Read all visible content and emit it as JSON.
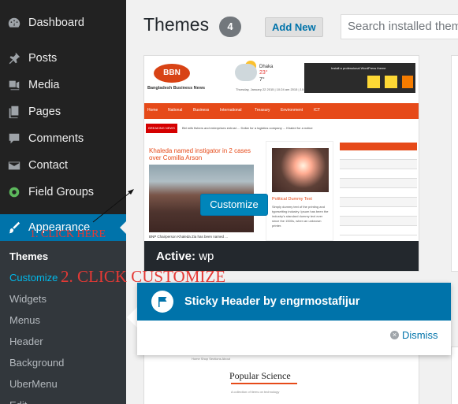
{
  "sidebar": {
    "items": [
      {
        "label": "Dashboard",
        "icon": "dashboard-icon"
      },
      {
        "label": "Posts",
        "icon": "pin-icon"
      },
      {
        "label": "Media",
        "icon": "media-icon"
      },
      {
        "label": "Pages",
        "icon": "pages-icon"
      },
      {
        "label": "Comments",
        "icon": "comment-icon"
      },
      {
        "label": "Contact",
        "icon": "mail-icon"
      },
      {
        "label": "Field Groups",
        "icon": "field-groups-icon"
      },
      {
        "label": "Appearance",
        "icon": "brush-icon"
      }
    ],
    "submenu": [
      "Themes",
      "Customize",
      "Widgets",
      "Menus",
      "Header",
      "Background",
      "UberMenu",
      "Edit"
    ]
  },
  "header": {
    "title": "Themes",
    "count": "4",
    "add_new": "Add New",
    "search_placeholder": "Search installed themes..."
  },
  "active_theme": {
    "screenshot": {
      "logo": "BBN",
      "logo_sub": "Bangladesh Business News",
      "weather_city": "Dhaka",
      "weather_hi": "23°",
      "weather_lo": "7°",
      "date": "Thursday, January 22  2015 | 10:24 am  2015 | 10:24 am",
      "ad_text": "Install a professional WordPress theme",
      "nav": [
        "Home",
        "National",
        "Business",
        "International",
        "Treasury",
        "Environment",
        "ICT"
      ],
      "breaking_label": "BREAKING NEWS",
      "breaking_text": "Bbl milk fishers and enterprises entrust ... Dollar for a logistics company ... Khaled for a notice",
      "headline": "Khaleda named instigator in 2 cases over Comilla Arson",
      "photo_caption": "BNP Chairperson Khaleda Zia has been named ...",
      "col2_head": "Political Dummy Text",
      "col2_text": "Simply dummy text of the printing and typesetting industry. Ipsum has been the industry's standard dummy text ever since the 1500s, when an unknown printer."
    },
    "active_prefix": "Active:",
    "name": "wp",
    "customize_button": "Customize"
  },
  "next_theme": {
    "nav": "Home   Shop Sections   About",
    "title": "Popular Science",
    "meta": "A collection of items on technology"
  },
  "pointer": {
    "title": "Sticky Header by engrmostafijur",
    "dismiss": "Dismiss"
  },
  "annotations": {
    "step1": "1. CLICK HERE",
    "step2": "2. CLICK CUSTOMIZE"
  },
  "colors": {
    "sidebar_bg": "#222222",
    "active_blue": "#0073aa",
    "annotation_red": "#e53935",
    "theme_accent": "#e64a19"
  }
}
